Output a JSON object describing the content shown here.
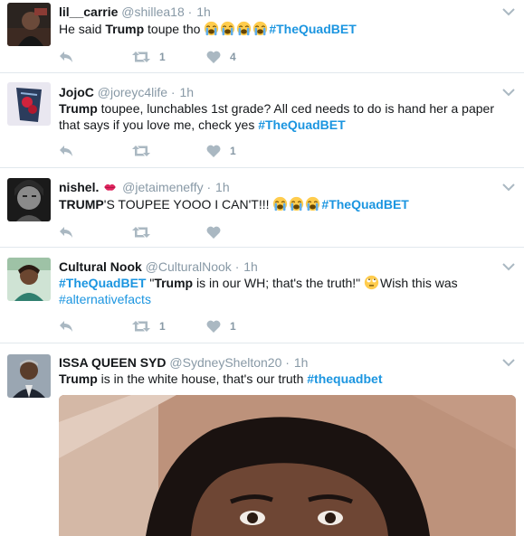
{
  "tweets": [
    {
      "fullname": "lil__carrie",
      "handle": "@shillea18",
      "time": "1h",
      "text_pre": "He said ",
      "bold": "Trump",
      "text_post": " toupe tho ",
      "emoji_count": 4,
      "hashtag": "#TheQuadBET",
      "retweets": "1",
      "likes": "4"
    },
    {
      "fullname": "JojoC",
      "handle": "@joreyc4life",
      "time": "1h",
      "bold": "Trump",
      "text_post": " toupee, lunchables 1st grade? All ced needs to do is hand her a paper that says if you love me, check yes ",
      "hashtag": "#TheQuadBET",
      "retweets": "",
      "likes": "1"
    },
    {
      "fullname": "nishel.",
      "handle": "@jetaimeneffy",
      "time": "1h",
      "bold": "TRUMP",
      "text_post": "'S TOUPEE YOOO I CAN'T!!! ",
      "emoji_count": 3,
      "hashtag": "#TheQuadBET",
      "retweets": "",
      "likes": ""
    },
    {
      "fullname": "Cultural Nook",
      "handle": "@CulturalNook",
      "time": "1h",
      "hashtag": "#TheQuadBET",
      "text_q1": " \"",
      "bold": "Trump",
      "text_q2": " is in our WH; that's the truth!\" ",
      "text_q3": "Wish this was",
      "hashtag2": "#alternativefacts",
      "retweets": "1",
      "likes": "1"
    },
    {
      "fullname": "ISSA QUEEN SYD",
      "handle": "@SydneyShelton20",
      "time": "1h",
      "bold": "Trump",
      "text_post": " is in the white house, that's our truth ",
      "hashtag": "#thequadbet"
    }
  ],
  "separator": "·",
  "icons": {
    "reply": "reply-icon",
    "retweet": "retweet-icon",
    "like": "heart-icon",
    "more": "chevron-down-icon",
    "crying": "loudly-crying-face-emoji",
    "thinking": "rolling-eyes-emoji",
    "lips": "kiss-lips-emoji"
  },
  "colors": {
    "hashtag": "#1b95e0",
    "meta": "#8899a6",
    "action": "#aab8c2",
    "divider": "#e1e8ed"
  }
}
